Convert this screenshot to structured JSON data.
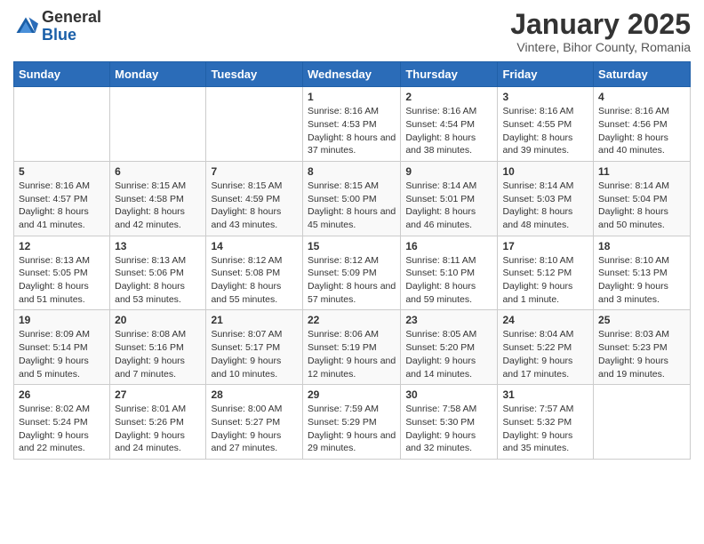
{
  "header": {
    "logo_general": "General",
    "logo_blue": "Blue",
    "month_title": "January 2025",
    "subtitle": "Vintere, Bihor County, Romania"
  },
  "weekdays": [
    "Sunday",
    "Monday",
    "Tuesday",
    "Wednesday",
    "Thursday",
    "Friday",
    "Saturday"
  ],
  "weeks": [
    [
      {
        "day": "",
        "info": ""
      },
      {
        "day": "",
        "info": ""
      },
      {
        "day": "",
        "info": ""
      },
      {
        "day": "1",
        "info": "Sunrise: 8:16 AM\nSunset: 4:53 PM\nDaylight: 8 hours and 37 minutes."
      },
      {
        "day": "2",
        "info": "Sunrise: 8:16 AM\nSunset: 4:54 PM\nDaylight: 8 hours and 38 minutes."
      },
      {
        "day": "3",
        "info": "Sunrise: 8:16 AM\nSunset: 4:55 PM\nDaylight: 8 hours and 39 minutes."
      },
      {
        "day": "4",
        "info": "Sunrise: 8:16 AM\nSunset: 4:56 PM\nDaylight: 8 hours and 40 minutes."
      }
    ],
    [
      {
        "day": "5",
        "info": "Sunrise: 8:16 AM\nSunset: 4:57 PM\nDaylight: 8 hours and 41 minutes."
      },
      {
        "day": "6",
        "info": "Sunrise: 8:15 AM\nSunset: 4:58 PM\nDaylight: 8 hours and 42 minutes."
      },
      {
        "day": "7",
        "info": "Sunrise: 8:15 AM\nSunset: 4:59 PM\nDaylight: 8 hours and 43 minutes."
      },
      {
        "day": "8",
        "info": "Sunrise: 8:15 AM\nSunset: 5:00 PM\nDaylight: 8 hours and 45 minutes."
      },
      {
        "day": "9",
        "info": "Sunrise: 8:14 AM\nSunset: 5:01 PM\nDaylight: 8 hours and 46 minutes."
      },
      {
        "day": "10",
        "info": "Sunrise: 8:14 AM\nSunset: 5:03 PM\nDaylight: 8 hours and 48 minutes."
      },
      {
        "day": "11",
        "info": "Sunrise: 8:14 AM\nSunset: 5:04 PM\nDaylight: 8 hours and 50 minutes."
      }
    ],
    [
      {
        "day": "12",
        "info": "Sunrise: 8:13 AM\nSunset: 5:05 PM\nDaylight: 8 hours and 51 minutes."
      },
      {
        "day": "13",
        "info": "Sunrise: 8:13 AM\nSunset: 5:06 PM\nDaylight: 8 hours and 53 minutes."
      },
      {
        "day": "14",
        "info": "Sunrise: 8:12 AM\nSunset: 5:08 PM\nDaylight: 8 hours and 55 minutes."
      },
      {
        "day": "15",
        "info": "Sunrise: 8:12 AM\nSunset: 5:09 PM\nDaylight: 8 hours and 57 minutes."
      },
      {
        "day": "16",
        "info": "Sunrise: 8:11 AM\nSunset: 5:10 PM\nDaylight: 8 hours and 59 minutes."
      },
      {
        "day": "17",
        "info": "Sunrise: 8:10 AM\nSunset: 5:12 PM\nDaylight: 9 hours and 1 minute."
      },
      {
        "day": "18",
        "info": "Sunrise: 8:10 AM\nSunset: 5:13 PM\nDaylight: 9 hours and 3 minutes."
      }
    ],
    [
      {
        "day": "19",
        "info": "Sunrise: 8:09 AM\nSunset: 5:14 PM\nDaylight: 9 hours and 5 minutes."
      },
      {
        "day": "20",
        "info": "Sunrise: 8:08 AM\nSunset: 5:16 PM\nDaylight: 9 hours and 7 minutes."
      },
      {
        "day": "21",
        "info": "Sunrise: 8:07 AM\nSunset: 5:17 PM\nDaylight: 9 hours and 10 minutes."
      },
      {
        "day": "22",
        "info": "Sunrise: 8:06 AM\nSunset: 5:19 PM\nDaylight: 9 hours and 12 minutes."
      },
      {
        "day": "23",
        "info": "Sunrise: 8:05 AM\nSunset: 5:20 PM\nDaylight: 9 hours and 14 minutes."
      },
      {
        "day": "24",
        "info": "Sunrise: 8:04 AM\nSunset: 5:22 PM\nDaylight: 9 hours and 17 minutes."
      },
      {
        "day": "25",
        "info": "Sunrise: 8:03 AM\nSunset: 5:23 PM\nDaylight: 9 hours and 19 minutes."
      }
    ],
    [
      {
        "day": "26",
        "info": "Sunrise: 8:02 AM\nSunset: 5:24 PM\nDaylight: 9 hours and 22 minutes."
      },
      {
        "day": "27",
        "info": "Sunrise: 8:01 AM\nSunset: 5:26 PM\nDaylight: 9 hours and 24 minutes."
      },
      {
        "day": "28",
        "info": "Sunrise: 8:00 AM\nSunset: 5:27 PM\nDaylight: 9 hours and 27 minutes."
      },
      {
        "day": "29",
        "info": "Sunrise: 7:59 AM\nSunset: 5:29 PM\nDaylight: 9 hours and 29 minutes."
      },
      {
        "day": "30",
        "info": "Sunrise: 7:58 AM\nSunset: 5:30 PM\nDaylight: 9 hours and 32 minutes."
      },
      {
        "day": "31",
        "info": "Sunrise: 7:57 AM\nSunset: 5:32 PM\nDaylight: 9 hours and 35 minutes."
      },
      {
        "day": "",
        "info": ""
      }
    ]
  ]
}
